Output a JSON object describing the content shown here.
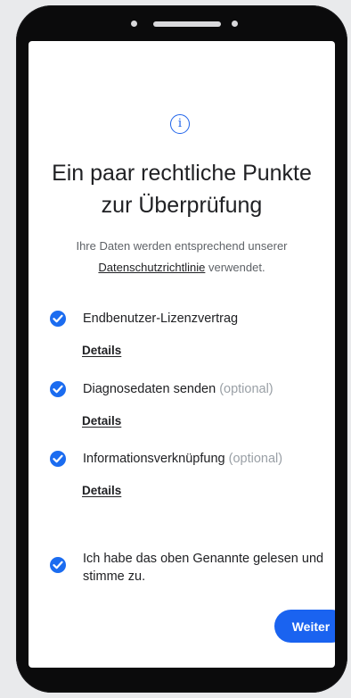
{
  "header": {
    "info_icon": "info-circle-icon",
    "title_line1": "Ein paar rechtliche Punkte",
    "title_line2": "zur Überprüfung"
  },
  "intro": {
    "line1": "Ihre Daten werden entsprechend unserer",
    "link": "Datenschutzrichtlinie",
    "line2_suffix": " verwendet."
  },
  "items": [
    {
      "label": "Endbenutzer-Lizenzvertrag",
      "optional": "",
      "checked": true,
      "details": "Details"
    },
    {
      "label": "Diagnosedaten senden",
      "optional": "(optional)",
      "checked": true,
      "details": "Details"
    },
    {
      "label": "Informationsverknüpfung",
      "optional": "(optional)",
      "checked": true,
      "details": "Details"
    }
  ],
  "consent": {
    "label": "Ich habe das oben Genannte gelesen und stimme zu.",
    "checked": true
  },
  "actions": {
    "next": "Weiter"
  },
  "colors": {
    "accent": "#1b6cf0",
    "text": "#202124",
    "muted": "#9aa0a6"
  }
}
